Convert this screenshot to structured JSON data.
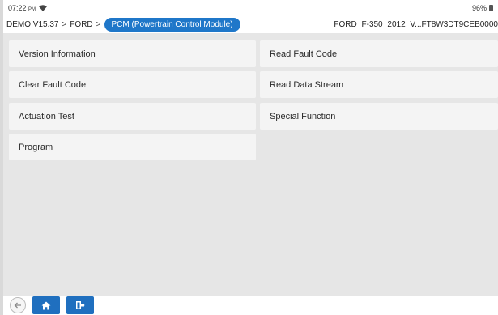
{
  "status_bar": {
    "time": "07:22",
    "ampm": "PM",
    "battery": "96%"
  },
  "header": {
    "breadcrumb": {
      "part1": "DEMO V15.37",
      "separator": ">",
      "part2": "FORD",
      "active": "PCM (Powertrain Control Module)"
    },
    "vehicle_info": "FORD  F-350  2012  V...FT8W3DT9CEB0000"
  },
  "menu": {
    "version_information": "Version Information",
    "read_fault_code": "Read Fault Code",
    "clear_fault_code": "Clear Fault Code",
    "read_data_stream": "Read Data Stream",
    "actuation_test": "Actuation Test",
    "special_function": "Special Function",
    "program": "Program"
  },
  "icons": {
    "wifi": "wifi-icon",
    "battery": "battery-icon",
    "back": "arrow-left-icon",
    "home": "home-icon",
    "exit": "exit-icon"
  },
  "colors": {
    "accent": "#1f77c9",
    "nav_button": "#1f6fbf",
    "content_bg": "#e6e6e6",
    "menu_button_bg": "#f4f4f4"
  }
}
